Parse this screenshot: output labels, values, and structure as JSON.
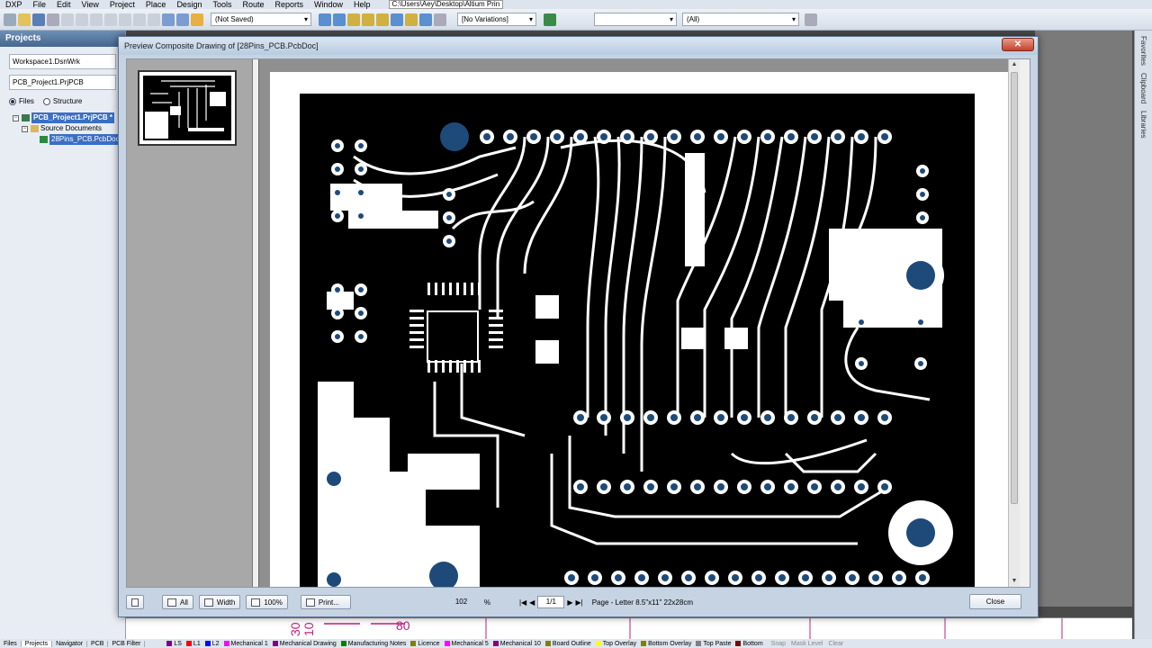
{
  "menubar": {
    "items": [
      "DXP",
      "File",
      "Edit",
      "View",
      "Project",
      "Place",
      "Design",
      "Tools",
      "Route",
      "Reports",
      "Window",
      "Help"
    ],
    "path": "C:\\Users\\Aey\\Desktop\\Altium Prin"
  },
  "toolbar": {
    "save_state": "(Not Saved)",
    "variations": "[No Variations]",
    "filter": "(All)"
  },
  "projects_panel": {
    "title": "Projects",
    "workspace": "Workspace1.DsnWrk",
    "project": "PCB_Project1.PrjPCB",
    "view_files": "Files",
    "view_structure": "Structure",
    "tree": {
      "project": "PCB_Project1.PrjPCB *",
      "folder": "Source Documents",
      "document": "28Pins_PCB.PcbDoc"
    }
  },
  "right_panel": {
    "tabs": [
      "Favorites",
      "Clipboard",
      "Libraries"
    ]
  },
  "dialog": {
    "title": "Preview Composite Drawing of [28Pins_PCB.PcbDoc]",
    "close_x": "✕",
    "footer": {
      "all_label": "All",
      "width_label": "Width",
      "zoom100_label": "100%",
      "print_label": "Print...",
      "zoom_value": "102",
      "zoom_unit": "%",
      "page_current": "1/1",
      "page_info": "Page - Letter 8.5\"x11\" 22x28cm",
      "close_label": "Close"
    }
  },
  "statusbar": {
    "panel_tabs": [
      "Files",
      "Projects",
      "Navigator",
      "PCB",
      "PCB Filter"
    ],
    "layers": [
      {
        "name": "LS",
        "color": "#800080"
      },
      {
        "name": "L1",
        "color": "#ff0000"
      },
      {
        "name": "L2",
        "color": "#0000ff"
      },
      {
        "name": "Mechanical 1",
        "color": "#ff00ff"
      },
      {
        "name": "Mechanical Drawing",
        "color": "#800080"
      },
      {
        "name": "Manufacturing Notes",
        "color": "#008000"
      },
      {
        "name": "Licence",
        "color": "#808000"
      },
      {
        "name": "Mechanical 5",
        "color": "#ff00ff"
      },
      {
        "name": "Mechanical 10",
        "color": "#800080"
      },
      {
        "name": "Board Outline",
        "color": "#808000"
      },
      {
        "name": "Top Overlay",
        "color": "#ffff00"
      },
      {
        "name": "Bottom Overlay",
        "color": "#808000"
      },
      {
        "name": "Top Paste",
        "color": "#808080"
      },
      {
        "name": "Bottom",
        "color": "#800000"
      }
    ],
    "snap": "Snap",
    "mask_level": "Mask Level",
    "clear": "Clear"
  },
  "schematic_labels": {
    "a": "30",
    "b": "10",
    "c": "80"
  },
  "colors": {
    "panel_header": "#45668f",
    "selection": "#3a6fc4",
    "pad_blue": "#1e4a7a"
  }
}
